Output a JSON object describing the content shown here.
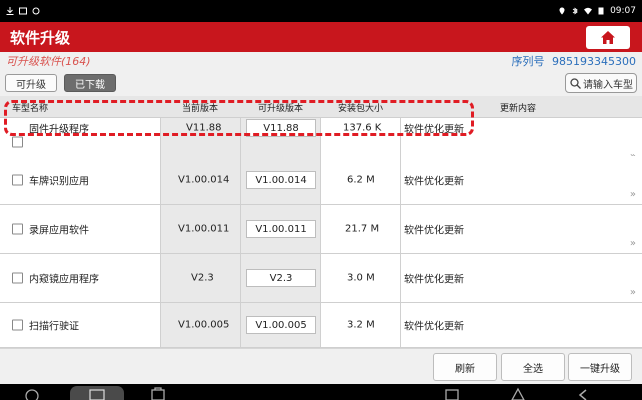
{
  "status_bar": {
    "time": "09:07"
  },
  "header": {
    "title": "软件升级"
  },
  "info": {
    "upgradable_count": "可升级软件(164)",
    "serial_label": "序列号",
    "serial_number": "985193345300"
  },
  "tabs": {
    "upgradable": "可升级",
    "downloaded": "已下载"
  },
  "search": {
    "placeholder": "请输入车型"
  },
  "table": {
    "headers": [
      "车型名称",
      "当前版本",
      "可升级版本",
      "安装包大小",
      "更新内容"
    ],
    "rows": [
      {
        "name": "固件升级程序",
        "current": "V11.88",
        "upgrade": "V11.88",
        "size": "137.6 K",
        "content": "软件优化更新"
      },
      {
        "name": "车牌识别应用",
        "current": "V1.00.014",
        "upgrade": "V1.00.014",
        "size": "6.2 M",
        "content": "软件优化更新"
      },
      {
        "name": "录屏应用软件",
        "current": "V1.00.011",
        "upgrade": "V1.00.011",
        "size": "21.7 M",
        "content": "软件优化更新"
      },
      {
        "name": "内窥镜应用程序",
        "current": "V2.3",
        "upgrade": "V2.3",
        "size": "3.0 M",
        "content": "软件优化更新"
      },
      {
        "name": "扫描行驶证",
        "current": "V1.00.005",
        "upgrade": "V1.00.005",
        "size": "3.2 M",
        "content": "软件优化更新"
      }
    ]
  },
  "footer": {
    "refresh": "刷新",
    "select_all": "全选",
    "one_click_upgrade": "一键升级"
  },
  "colors": {
    "brand_red": "#c8161d",
    "highlight": "#e01c24"
  },
  "icons": [
    "home-icon",
    "search-icon",
    "chevron-double-right-icon",
    "wifi-icon",
    "battery-icon"
  ]
}
